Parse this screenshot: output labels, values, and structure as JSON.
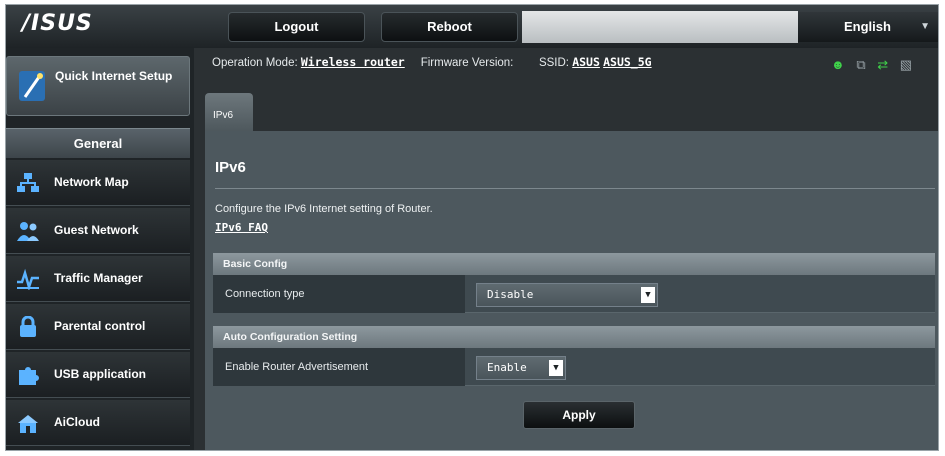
{
  "brand": {
    "logo": "/ISUS"
  },
  "topbar": {
    "logout_label": "Logout",
    "reboot_label": "Reboot",
    "language": "English"
  },
  "sidebar": {
    "quick_setup_label": "Quick Internet Setup",
    "section_header": "General",
    "items": [
      {
        "label": "Network Map",
        "icon": "network-map-icon"
      },
      {
        "label": "Guest Network",
        "icon": "guest-network-icon"
      },
      {
        "label": "Traffic Manager",
        "icon": "traffic-manager-icon"
      },
      {
        "label": "Parental control",
        "icon": "lock-icon"
      },
      {
        "label": "USB application",
        "icon": "puzzle-icon"
      },
      {
        "label": "AiCloud",
        "icon": "cloud-house-icon"
      }
    ]
  },
  "info": {
    "operation_mode_label": "Operation Mode:",
    "operation_mode_value": "Wireless router",
    "firmware_label": "Firmware Version:",
    "ssid_label": "SSID:",
    "ssid_1": "ASUS",
    "ssid_2": "ASUS_5G"
  },
  "tab": {
    "label": "IPv6"
  },
  "main": {
    "title": "IPv6",
    "description": "Configure the IPv6 Internet setting of Router.",
    "faq_link": "IPv6 FAQ",
    "basic_config_header": "Basic Config",
    "connection_type_label": "Connection type",
    "connection_type_value": "Disable",
    "auto_config_header": "Auto Configuration Setting",
    "router_adv_label": "Enable Router Advertisement",
    "router_adv_value": "Enable",
    "apply_label": "Apply"
  },
  "colors": {
    "accent_green": "#3fd14a",
    "panel": "#4d585e",
    "dark": "#1f2427"
  }
}
